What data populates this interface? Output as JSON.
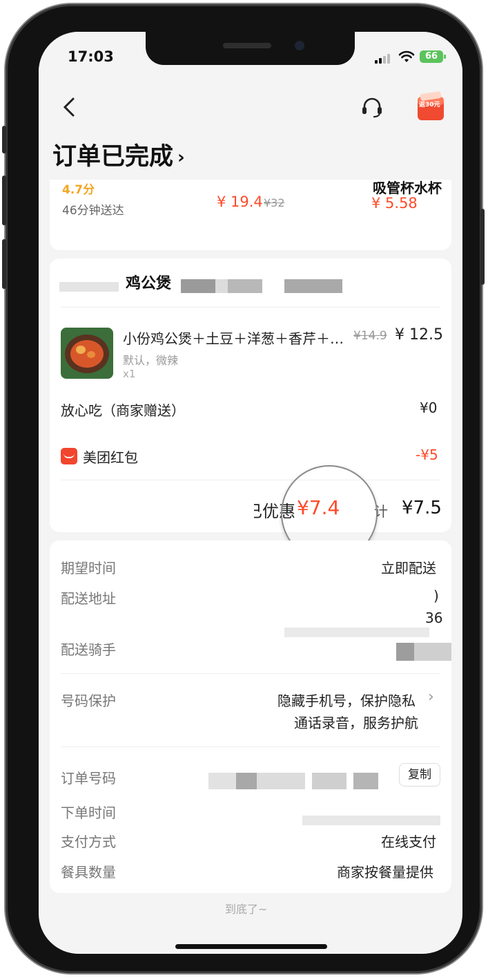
{
  "status_bar": {
    "time": "17:03",
    "battery": "66"
  },
  "header": {
    "title": "订单已完成",
    "promo_badge": "返30元"
  },
  "top_card": {
    "rating": "4.7分",
    "delivery_time": "46分钟送达",
    "price_now": "¥ 19.4",
    "price_old": "¥32",
    "item_name": "吸管杯水杯",
    "item_price": "¥ 5.58"
  },
  "order": {
    "shop_name_partial": "鸡公煲",
    "item": {
      "name": "小份鸡公煲＋土豆＋洋葱＋香芹＋…",
      "original_price": "¥14.9",
      "price": "¥ 12.5",
      "spec": "默认，微辣",
      "qty": "x1"
    },
    "free_item": {
      "label": "放心吃（商家赠送）",
      "value": "¥0"
    },
    "coupon": {
      "label": "美团红包",
      "value": "-¥5"
    },
    "summary": {
      "saved_prefix": "已优惠",
      "saved_value": "¥7.4",
      "total_label": "合计",
      "total_value": "¥7.5"
    }
  },
  "details": {
    "expected_time": {
      "label": "期望时间",
      "value": "立即配送"
    },
    "address": {
      "label": "配送地址",
      "value_line1": ")",
      "value_line2": "36"
    },
    "rider": {
      "label": "配送骑手"
    },
    "privacy": {
      "label": "号码保护",
      "line1": "隐藏手机号，保护隐私",
      "line2": "通话录音，服务护航"
    },
    "order_no": {
      "label": "订单号码",
      "copy_button": "复制"
    },
    "order_time": {
      "label": "下单时间"
    },
    "payment": {
      "label": "支付方式",
      "value": "在线支付"
    },
    "tableware": {
      "label": "餐具数量",
      "value": "商家按餐量提供"
    }
  },
  "footer": {
    "end_text": "到底了~"
  },
  "colors": {
    "accent_red": "#ff4a2a",
    "rating_orange": "#f5a623"
  },
  "icons": [
    "back-icon",
    "headset-icon",
    "red-packet-icon",
    "chevron-right-icon",
    "wifi-icon",
    "battery-icon"
  ]
}
